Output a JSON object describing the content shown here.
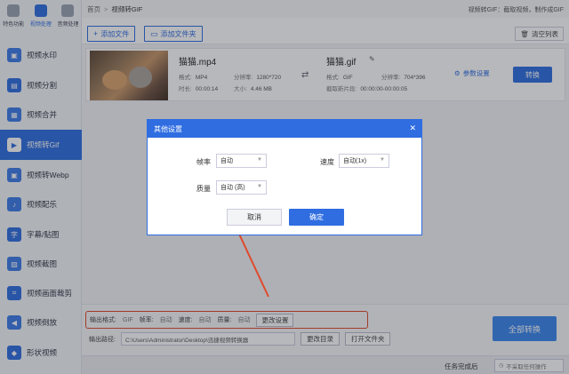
{
  "nav": {
    "top_categories": [
      {
        "label": "特色功能",
        "icon": "star-icon"
      },
      {
        "label": "视频处理",
        "icon": "film-icon"
      },
      {
        "label": "音频处理",
        "icon": "audio-icon"
      }
    ],
    "items": [
      {
        "label": "视频水印",
        "icon": "watermark-icon",
        "color": "#3b7be8"
      },
      {
        "label": "视频分割",
        "icon": "split-icon",
        "color": "#2f6de1"
      },
      {
        "label": "视频合并",
        "icon": "merge-icon",
        "color": "#3b7be8"
      },
      {
        "label": "视频转Gif",
        "icon": "gif-icon",
        "color": "#2f6de1"
      },
      {
        "label": "视频转Webp",
        "icon": "webp-icon",
        "color": "#3b7be8"
      },
      {
        "label": "视频配乐",
        "icon": "music-icon",
        "color": "#3b7be8"
      },
      {
        "label": "字幕/贴图",
        "icon": "subtitle-icon",
        "color": "#2f6de1"
      },
      {
        "label": "视频截图",
        "icon": "screenshot-icon",
        "color": "#3b7be8"
      },
      {
        "label": "视频画面裁剪",
        "icon": "crop-icon",
        "color": "#2f6de1"
      },
      {
        "label": "视频倒放",
        "icon": "reverse-icon",
        "color": "#3b7be8"
      },
      {
        "label": "形状视频",
        "icon": "shape-icon",
        "color": "#2f6de1"
      }
    ]
  },
  "header": {
    "home": "首页",
    "sep": ">",
    "current": "视频转GIF",
    "tip": "视频转GIF：截取视频，制作成GIF"
  },
  "toolbar": {
    "add_file": "添加文件",
    "add_folder": "添加文件夹",
    "clear_list": "清空列表"
  },
  "file": {
    "source_name": "猫猫.mp4",
    "format_label": "格式:",
    "format_value": "MP4",
    "resolution_label": "分辨率:",
    "resolution_value": "1280*720",
    "duration_label": "时长:",
    "duration_value": "00:00:14",
    "size_label": "大小:",
    "size_value": "4.46 MB",
    "target_name": "猫猫.gif",
    "target_format_label": "格式:",
    "target_format_value": "GIF",
    "target_resolution_label": "分辨率:",
    "target_resolution_value": "704*396",
    "clip_label": "截取新片段:",
    "clip_value": "00:00:00-00:00:05",
    "param_settings": "参数设置",
    "convert": "转换"
  },
  "modal": {
    "title": "其他设置",
    "framerate_label": "帧率",
    "framerate_value": "自动",
    "speed_label": "速度",
    "speed_value": "自动(1x)",
    "quality_label": "质量",
    "quality_value": "自动 (高)",
    "cancel": "取消",
    "ok": "确定"
  },
  "bottom": {
    "output_format_label": "输出格式:",
    "output_format_value": "GIF",
    "framerate_label": "帧率:",
    "framerate_value": "自动",
    "speed_label": "速度:",
    "speed_value": "自动",
    "quality_label": "质量:",
    "quality_value": "自动",
    "change_settings": "更改设置",
    "output_path_label": "输出路径:",
    "output_path_value": "C:\\Users\\Administrator\\Desktop\\迅捷视频转换器",
    "change_dir": "更改目录",
    "open_folder": "打开文件夹",
    "convert_all": "全部转换"
  },
  "status": {
    "after_label": "任务完成后",
    "after_value": "不采取任何操作"
  },
  "colors": {
    "accent": "#2f6de1",
    "highlight_box": "#e0492b"
  }
}
